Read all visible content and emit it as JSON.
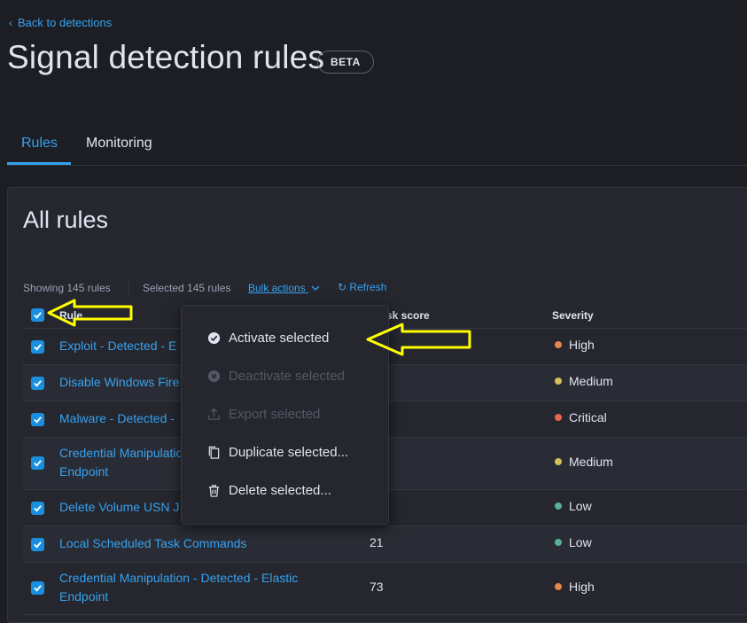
{
  "nav": {
    "back_label": "Back to detections"
  },
  "header": {
    "title": "Signal detection rules",
    "badge": "BETA"
  },
  "tabs": [
    {
      "label": "Rules",
      "active": true
    },
    {
      "label": "Monitoring",
      "active": false
    }
  ],
  "panel": {
    "title": "All rules",
    "utility": {
      "showing": "Showing 145 rules",
      "selected": "Selected 145 rules",
      "bulk_actions": "Bulk actions",
      "refresh": "Refresh"
    }
  },
  "table": {
    "headers": {
      "rule": "Rule",
      "risk_score": "sk score",
      "severity": "Severity"
    },
    "rows": [
      {
        "rule": "Exploit - Detected - E",
        "score": "",
        "severity": "High",
        "checked": true
      },
      {
        "rule": "Disable Windows Fire",
        "score": "",
        "severity": "Medium",
        "checked": true
      },
      {
        "rule": "Malware - Detected -",
        "score": "",
        "severity": "Critical",
        "checked": true
      },
      {
        "rule_line1": "Credential Manipulatio",
        "rule_line2": "Endpoint",
        "score": "",
        "severity": "Medium",
        "checked": true
      },
      {
        "rule": "Delete Volume USN J",
        "score": "",
        "severity": "Low",
        "checked": true
      },
      {
        "rule": "Local Scheduled Task Commands",
        "score": "21",
        "severity": "Low",
        "checked": true
      },
      {
        "rule_line1": "Credential Manipulation - Detected - Elastic",
        "rule_line2": "Endpoint",
        "score": "73",
        "severity": "High",
        "checked": true
      }
    ]
  },
  "bulk_menu": {
    "items": [
      {
        "label": "Activate selected",
        "icon": "check-circle-icon",
        "enabled": true
      },
      {
        "label": "Deactivate selected",
        "icon": "cross-circle-icon",
        "enabled": false
      },
      {
        "label": "Export selected",
        "icon": "export-icon",
        "enabled": false
      },
      {
        "label": "Duplicate selected...",
        "icon": "copy-icon",
        "enabled": true
      },
      {
        "label": "Delete selected...",
        "icon": "trash-icon",
        "enabled": true
      }
    ]
  },
  "colors": {
    "accent": "#36a2ef",
    "annotation_arrow": "#ffff00",
    "severity_high": "#e7864d",
    "severity_medium": "#d6bf57",
    "severity_critical": "#e7664c",
    "severity_low": "#54b399"
  }
}
